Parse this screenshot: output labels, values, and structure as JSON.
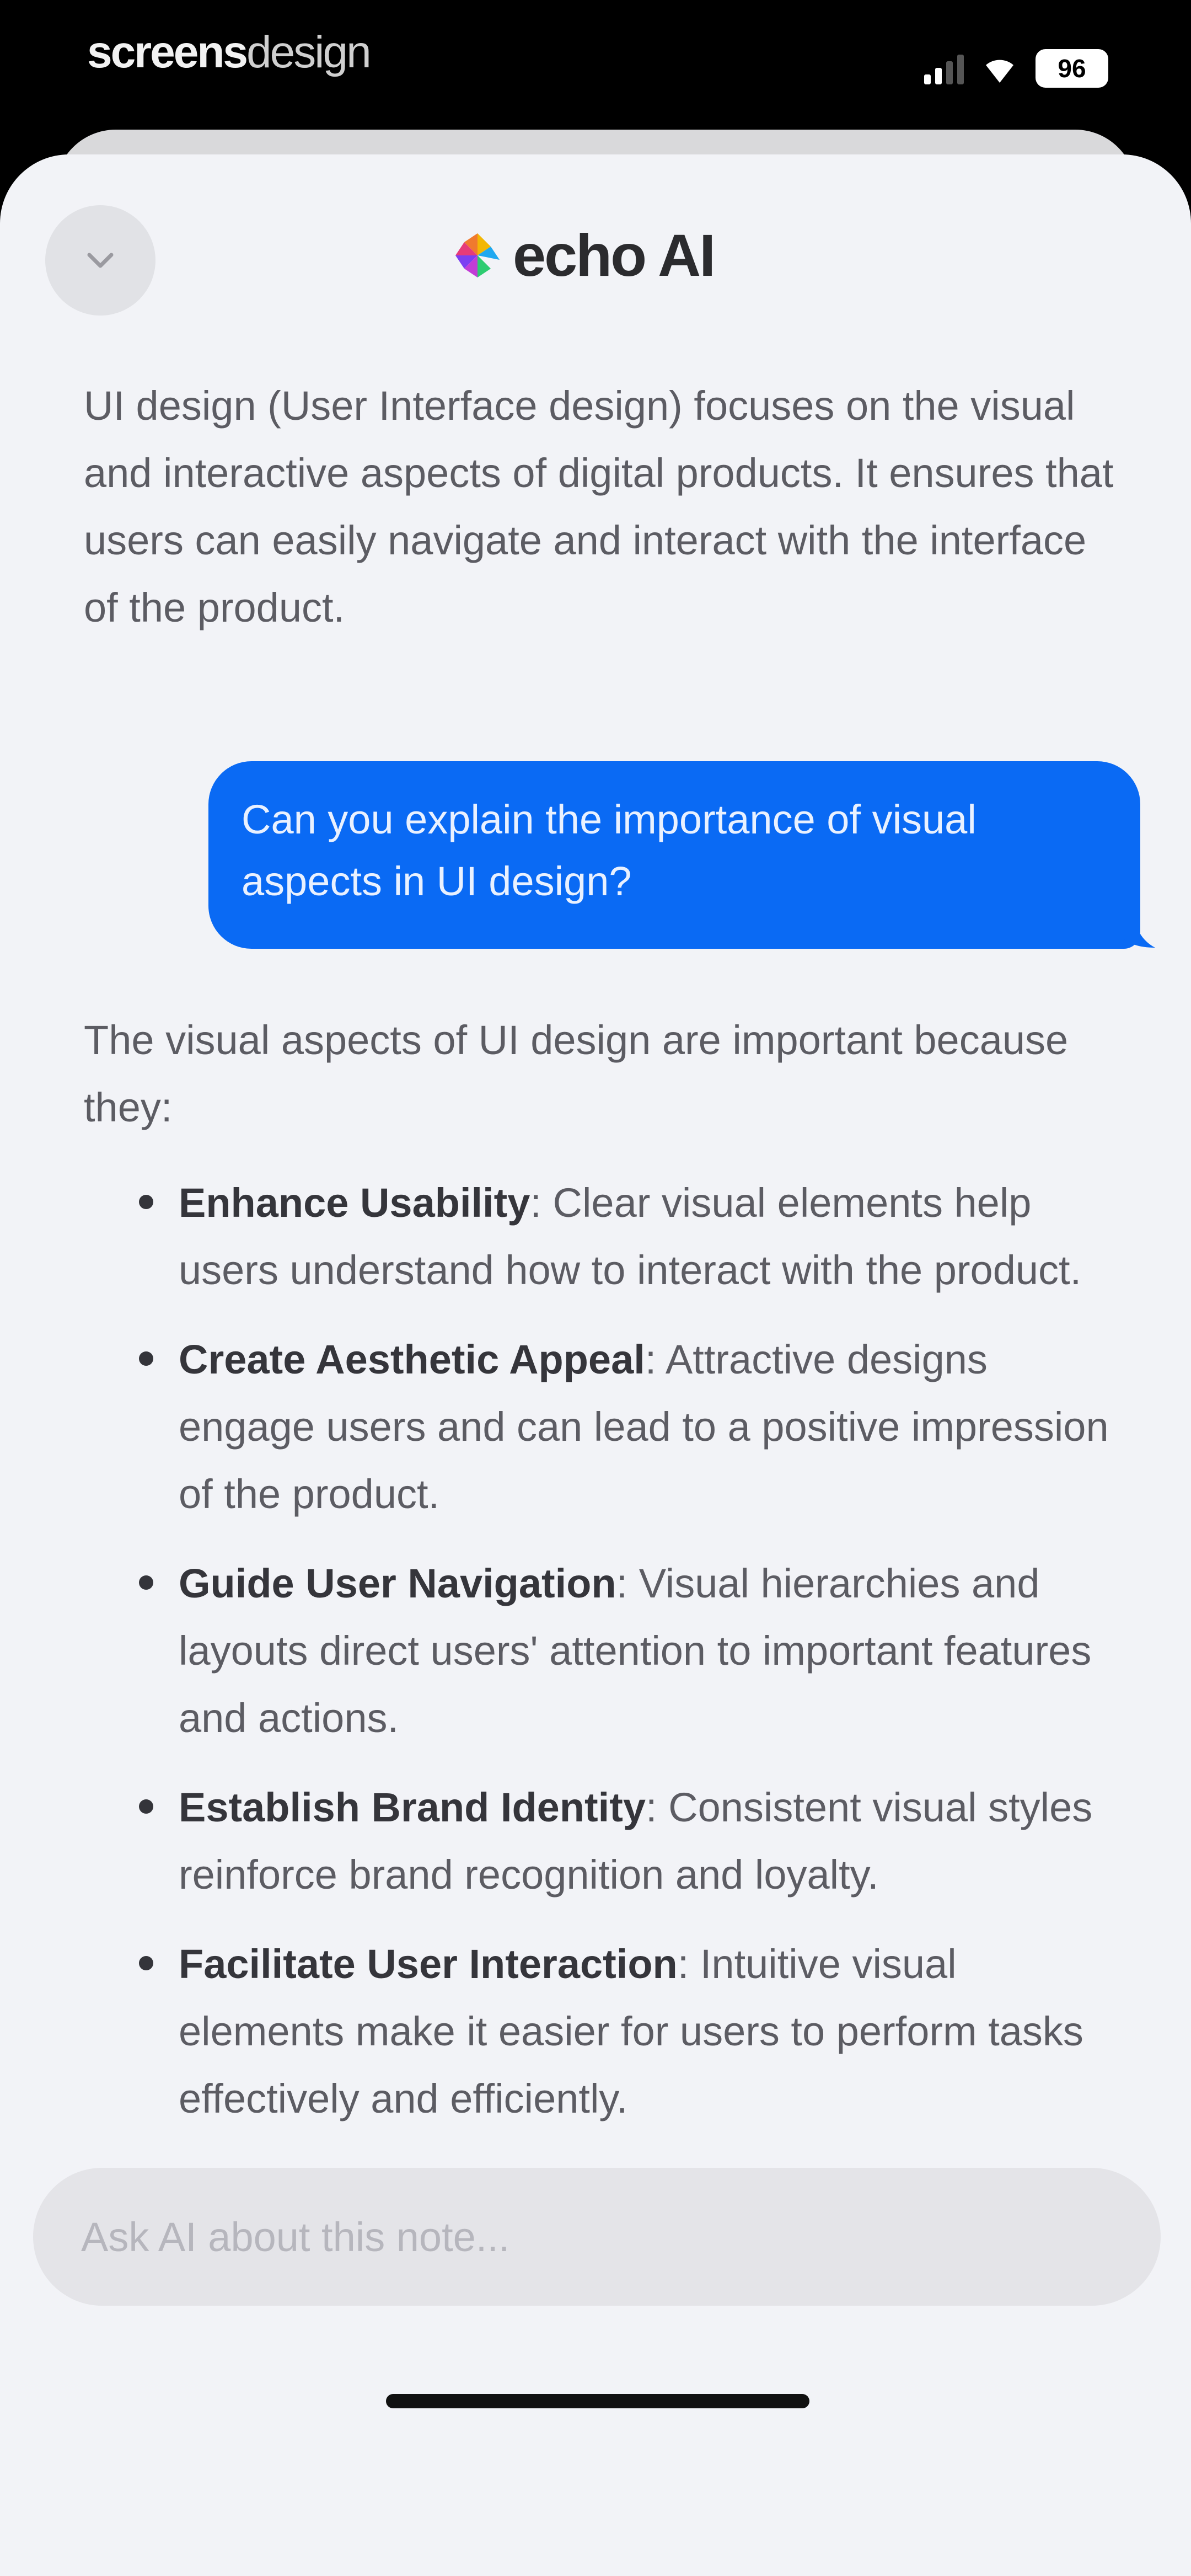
{
  "status_bar": {
    "brand_bold": "screens",
    "brand_light": "design",
    "battery": "96",
    "signal_icon": "cellular-signal-icon",
    "wifi_icon": "wifi-icon"
  },
  "header": {
    "title": "echo AI",
    "collapse_icon": "chevron-down-icon",
    "logo_colors": [
      "#f2b705",
      "#e63b7a",
      "#7b3ff2",
      "#1fa8f0",
      "#2ecc71"
    ]
  },
  "conversation": {
    "ai_intro_paragraph": "UI design (User Interface design) focuses on the visual and interactive aspects of digital products. It ensures that users can easily navigate and interact with the interface of the product.",
    "user_message": "Can you explain the importance of visual aspects in UI design?",
    "ai_answer_intro": "The visual aspects of UI design are important because they:",
    "ai_answer_points": [
      {
        "term": "Enhance Usability",
        "text": ": Clear visual elements help users understand how to interact with the product."
      },
      {
        "term": "Create Aesthetic Appeal",
        "text": ": Attractive designs engage users and can lead to a positive impression of the product."
      },
      {
        "term": "Guide User Navigation",
        "text": ": Visual hierarchies and layouts direct users' attention to important features and actions."
      },
      {
        "term": "Establish Brand Identity",
        "text": ": Consistent visual styles reinforce brand recognition and loyalty."
      },
      {
        "term": "Facilitate User Interaction",
        "text": ": Intuitive visual elements make it easier for users to perform tasks effectively and efficiently."
      }
    ]
  },
  "composer": {
    "placeholder": "Ask AI about this note...",
    "value": ""
  },
  "colors": {
    "user_bubble": "#0a6af4",
    "sheet_background": "#f2f3f7"
  }
}
